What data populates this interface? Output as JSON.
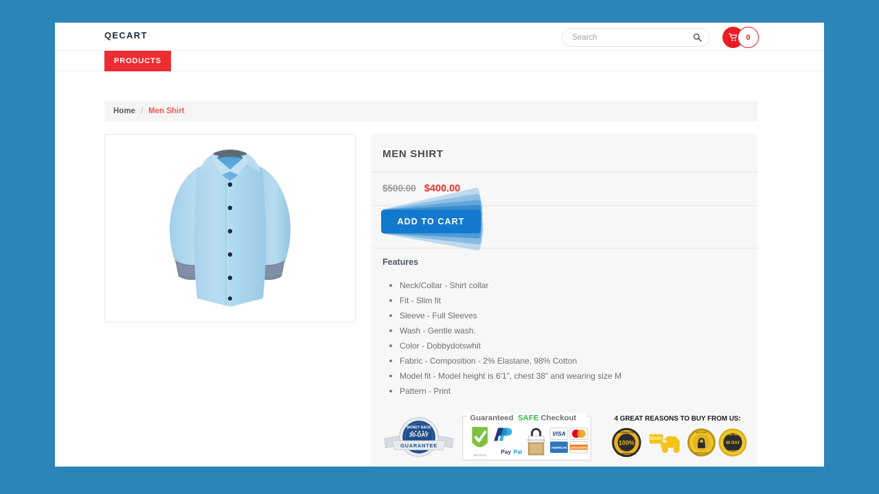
{
  "theme": {
    "desktop_background": "#2b85b9",
    "accent_red": "#ed1c24",
    "nav_red": "#ee2d32",
    "price_sale_red": "#f03030",
    "button_blue": "#1379ce",
    "panel_gray": "#f7f7f7"
  },
  "header": {
    "brand": "QECART",
    "search": {
      "value": "",
      "placeholder": "Search",
      "icon": "search-icon"
    },
    "cart": {
      "icon": "shopping-cart-icon",
      "count": "0"
    }
  },
  "nav": {
    "items": [
      {
        "label": "PRODUCTS",
        "active": true
      }
    ]
  },
  "breadcrumb": {
    "home": "Home",
    "separator": "/",
    "current": "Men Shirt"
  },
  "product": {
    "image_alt": "light-blue-mens-dress-shirt",
    "title": "MEN SHIRT",
    "price_old": "$500.00",
    "price_new": "$400.00",
    "add_to_cart_label": "ADD TO CART",
    "features_heading": "Features",
    "features": [
      "Neck/Collar - Shirt collar",
      "Fit - Slim fit",
      "Sleeve - Full Sleeves",
      "Wash - Gentle wash.",
      "Color - Dobbydotswhit",
      "Fabric - Composition - 2% Elastane, 98% Cotton",
      "Model fit - Model height is 6'1\", chest 38\" and wearing size M",
      "Pattern - Print"
    ]
  },
  "trust_badges": {
    "money_back": {
      "top_text": "MONEY BACK",
      "days": "30-DAY",
      "ribbon": "GUARANTEE"
    },
    "safe_checkout": {
      "title_1": "Guaranteed",
      "title_2": "SAFE",
      "title_3": "Checkout",
      "methods": [
        "PayPal",
        "Secure Lock",
        "VISA",
        "MasterCard",
        "AMEX",
        "DISCOVER"
      ]
    },
    "reasons": {
      "heading": "4 GREAT REASONS TO BUY FROM US:",
      "items": [
        {
          "label": "100%",
          "sub": "SATISFACTION GUARANTEED"
        },
        {
          "label": "EASY",
          "sub": "SHIPPING"
        },
        {
          "label": "SECURE",
          "sub": "ORDERING"
        },
        {
          "label": "30 DAY",
          "sub": "MONEY BACK GUARANTEE"
        }
      ]
    }
  }
}
